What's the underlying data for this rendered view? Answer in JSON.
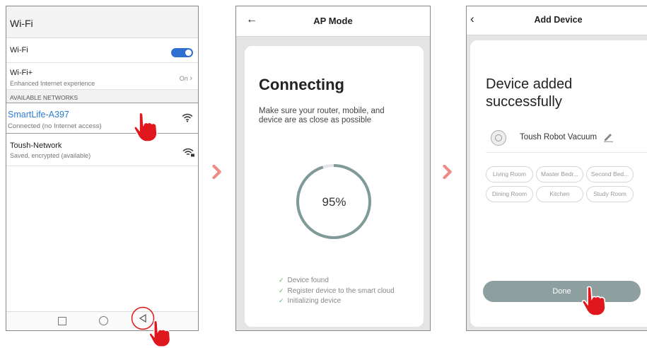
{
  "wifi_screen": {
    "title": "Wi-Fi",
    "wifi_row_label": "Wi-Fi",
    "wifi_enabled": true,
    "wifi_plus": {
      "label": "Wi-Fi+",
      "subtitle": "Enhanced Internet experience",
      "value": "On"
    },
    "section_header": "AVAILABLE NETWORKS",
    "networks": [
      {
        "name": "SmartLife-A397",
        "status": "Connected (no Internet access)",
        "highlighted": true
      },
      {
        "name": "Toush-Network",
        "status": "Saved, encrypted (available)",
        "highlighted": false
      }
    ],
    "nav": [
      "square",
      "circle",
      "back"
    ]
  },
  "ap_screen": {
    "title": "AP Mode",
    "heading": "Connecting",
    "hint": "Make sure your router, mobile, and device are as close as possible",
    "progress_percent": 95,
    "progress_label": "95%",
    "steps": [
      "Device found",
      "Register device to the smart cloud",
      "Initializing device"
    ]
  },
  "add_screen": {
    "title": "Add Device",
    "heading": "Device added successfully",
    "device_name": "Toush Robot Vacuum",
    "rooms": [
      "Living Room",
      "Master Bedr...",
      "Second Bed...",
      "Dining Room",
      "Kitchen",
      "Study Room"
    ],
    "done_label": "Done"
  },
  "colors": {
    "accent_blue": "#2d7bd4",
    "chevron": "#f08a86",
    "progress": "#7f9a99",
    "hand": "#e0181e",
    "done": "#8d9f9f"
  }
}
